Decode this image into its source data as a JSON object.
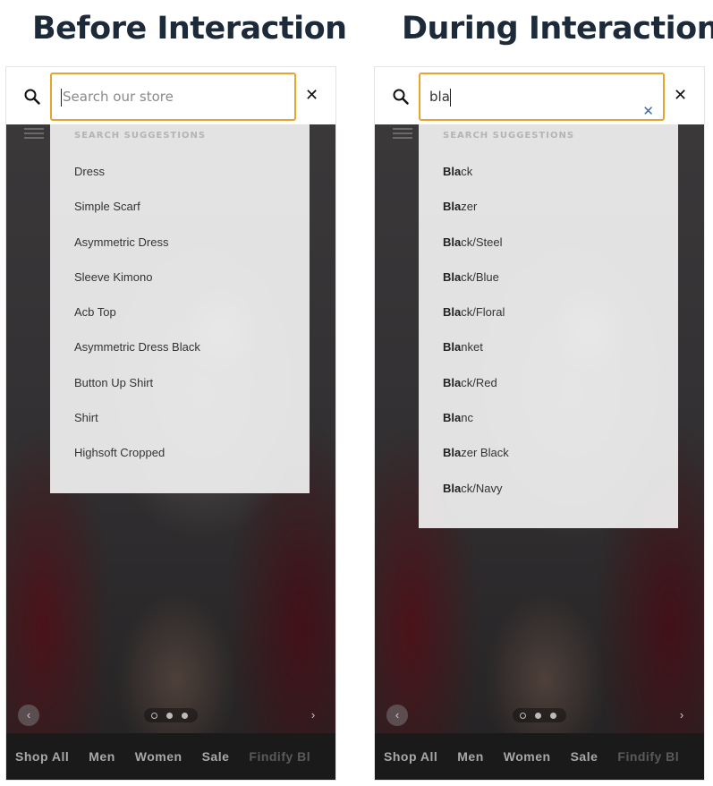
{
  "headings": {
    "before": "Before Interaction",
    "during": "During Interaction"
  },
  "before": {
    "search": {
      "placeholder": "Search our store",
      "value": ""
    },
    "suggestions_title": "SEARCH SUGGESTIONS",
    "suggestions": [
      "Dress",
      "Simple Scarf",
      "Asymmetric Dress",
      "Sleeve Kimono",
      "Acb Top",
      "Asymmetric Dress Black",
      "Button Up Shirt",
      "Shirt",
      "Highsoft Cropped"
    ]
  },
  "during": {
    "search": {
      "placeholder": "Search our store",
      "value": "bla"
    },
    "suggestions_title": "SEARCH SUGGESTIONS",
    "suggestions": [
      {
        "match": "Bla",
        "rest": "ck"
      },
      {
        "match": "Bla",
        "rest": "zer"
      },
      {
        "match": "Bla",
        "rest": "ck/Steel"
      },
      {
        "match": "Bla",
        "rest": "ck/Blue"
      },
      {
        "match": "Bla",
        "rest": "ck/Floral"
      },
      {
        "match": "Bla",
        "rest": "nket"
      },
      {
        "match": "Bla",
        "rest": "ck/Red"
      },
      {
        "match": "Bla",
        "rest": "nc"
      },
      {
        "match": "Bla",
        "rest": "zer Black"
      },
      {
        "match": "Bla",
        "rest": "ck/Navy"
      }
    ]
  },
  "nav": {
    "items": [
      "Shop All",
      "Men",
      "Women",
      "Sale",
      "Findify Bl"
    ]
  },
  "icons": {
    "search": "search-icon",
    "close": "close-icon",
    "clear": "clear-icon",
    "menu": "menu-icon",
    "prev": "chevron-left-icon",
    "next": "chevron-right-icon"
  },
  "colors": {
    "heading": "#1d2a3a",
    "input_border": "#e6a42a",
    "clear_x": "#3b6ea5",
    "nav_bg": "#1b1a1b"
  },
  "symbols": {
    "close": "✕",
    "clear": "✕",
    "prev": "‹",
    "next": "›"
  }
}
